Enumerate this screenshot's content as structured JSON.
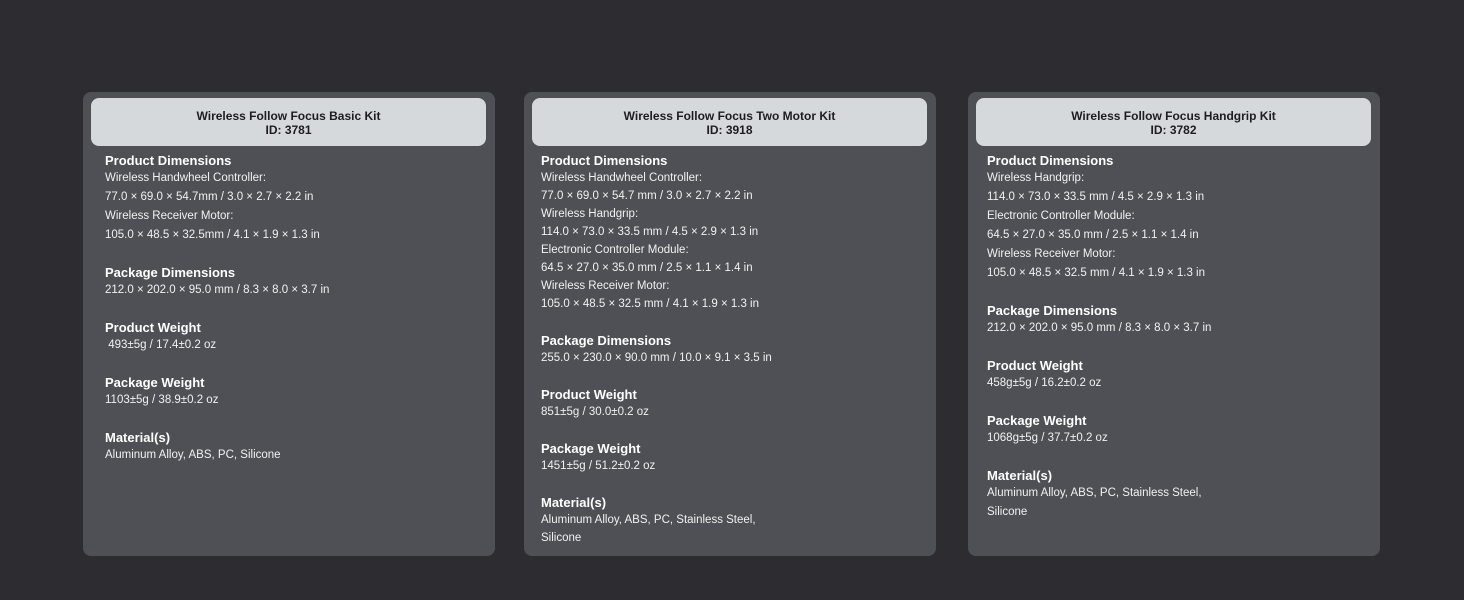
{
  "cards": [
    {
      "title": "Wireless Follow Focus Basic Kit",
      "id": "ID: 3781",
      "sections": [
        {
          "title": "Product Dimensions",
          "lines": [
            "Wireless Handwheel Controller:",
            "77.0 × 69.0 × 54.7mm / 3.0 × 2.7 × 2.2 in",
            "Wireless Receiver Motor:",
            "105.0 × 48.5 × 32.5mm / 4.1 × 1.9 × 1.3 in"
          ]
        },
        {
          "title": "Package Dimensions",
          "lines": [
            "212.0 × 202.0 × 95.0 mm / 8.3 × 8.0 × 3.7 in"
          ]
        },
        {
          "title": "Product Weight",
          "lines": [
            " 493±5g / 17.4±0.2 oz"
          ]
        },
        {
          "title": "Package Weight",
          "lines": [
            "1103±5g / 38.9±0.2 oz"
          ]
        },
        {
          "title": "Material(s)",
          "lines": [
            "Aluminum Alloy, ABS, PC, Silicone"
          ]
        }
      ]
    },
    {
      "title": "Wireless Follow Focus Two Motor Kit",
      "id": "ID: 3918",
      "sections": [
        {
          "title": "Product Dimensions",
          "lines": [
            "Wireless Handwheel Controller:",
            "77.0 × 69.0 × 54.7 mm / 3.0 × 2.7 × 2.2 in",
            "Wireless Handgrip:",
            "114.0 × 73.0 × 33.5 mm / 4.5 × 2.9 × 1.3 in",
            "Electronic Controller Module:",
            "64.5 × 27.0 × 35.0 mm / 2.5 × 1.1 × 1.4 in",
            "Wireless Receiver Motor:",
            "105.0 × 48.5 × 32.5 mm / 4.1 × 1.9 × 1.3 in"
          ]
        },
        {
          "title": "Package Dimensions",
          "lines": [
            "255.0 × 230.0 × 90.0 mm / 10.0 × 9.1 × 3.5 in"
          ]
        },
        {
          "title": "Product Weight",
          "lines": [
            "851±5g / 30.0±0.2 oz"
          ]
        },
        {
          "title": "Package Weight",
          "lines": [
            "1451±5g / 51.2±0.2 oz"
          ]
        },
        {
          "title": "Material(s)",
          "lines": [
            "Aluminum Alloy, ABS, PC, Stainless Steel,",
            "Silicone"
          ]
        }
      ]
    },
    {
      "title": "Wireless Follow Focus Handgrip Kit",
      "id": "ID: 3782",
      "sections": [
        {
          "title": "Product Dimensions",
          "lines": [
            "Wireless Handgrip:",
            "114.0 × 73.0 × 33.5 mm / 4.5 × 2.9 × 1.3 in",
            "Electronic Controller Module:",
            "64.5 × 27.0 × 35.0 mm / 2.5 × 1.1 × 1.4 in",
            "Wireless Receiver Motor:",
            "105.0 × 48.5 × 32.5 mm / 4.1 × 1.9 × 1.3 in"
          ]
        },
        {
          "title": "Package Dimensions",
          "lines": [
            "212.0 × 202.0 × 95.0 mm / 8.3 × 8.0 × 3.7 in"
          ]
        },
        {
          "title": "Product Weight",
          "lines": [
            "458g±5g / 16.2±0.2 oz"
          ]
        },
        {
          "title": "Package Weight",
          "lines": [
            "1068g±5g / 37.7±0.2 oz"
          ]
        },
        {
          "title": "Material(s)",
          "lines": [
            "Aluminum Alloy, ABS, PC, Stainless Steel,",
            "Silicone"
          ]
        }
      ]
    }
  ]
}
